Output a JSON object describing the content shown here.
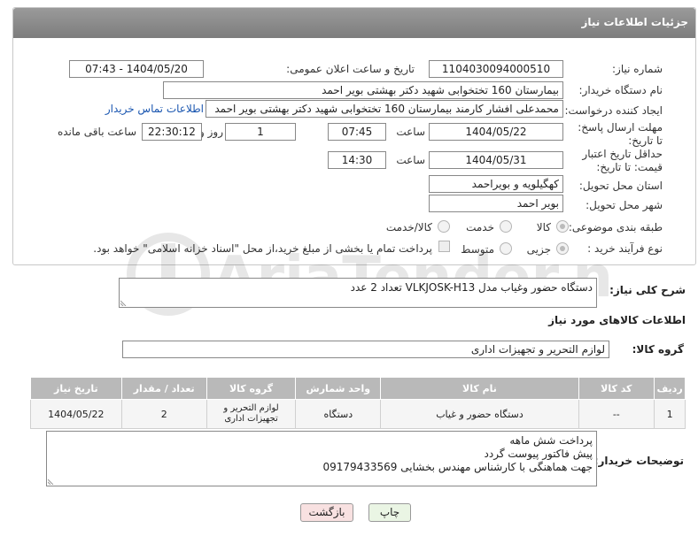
{
  "header": {
    "title": "جزئیات اطلاعات نیاز"
  },
  "form": {
    "need_number_label": "شماره نیاز:",
    "need_number": "1104030094000510",
    "announce_label": "تاریخ و ساعت اعلان عمومی:",
    "announce_value": "1404/05/20 - 07:43",
    "buyer_org_label": "نام دستگاه خریدار:",
    "buyer_org": "بیمارستان 160 تختخوابی شهید دکتر بهشتی بویر احمد",
    "creator_label": "ایجاد کننده درخواست:",
    "creator": "محمدعلی افشار کارمند بیمارستان 160 تختخوابی شهید دکتر بهشتی بویر احمد",
    "contact_link": "اطلاعات تماس خریدار",
    "deadline_label": "مهلت ارسال پاسخ: تا تاریخ:",
    "deadline_date": "1404/05/22",
    "time_label": "ساعت",
    "deadline_time": "07:45",
    "days_value": "1",
    "days_label": "روز و",
    "remaining_time": "22:30:12",
    "remaining_label": "ساعت باقی مانده",
    "validity_label": "حداقل تاریخ اعتبار قیمت: تا تاریخ:",
    "validity_date": "1404/05/31",
    "validity_time": "14:30",
    "province_label": "استان محل تحویل:",
    "province": "کهگیلویه و بویراحمد",
    "city_label": "شهر محل تحویل:",
    "city": "بویر احمد",
    "category_label": "طبقه بندی موضوعی:",
    "category_options": [
      "کالا",
      "خدمت",
      "کالا/خدمت"
    ],
    "category_selected": "کالا",
    "process_label": "نوع فرآیند خرید :",
    "process_options": [
      "جزیی",
      "متوسط"
    ],
    "process_selected": "جزیی",
    "payment_note": "پرداخت تمام یا بخشی از مبلغ خرید،از محل \"اسناد خزانه اسلامی\" خواهد بود."
  },
  "description": {
    "label": "شرح کلی نیاز:",
    "text": "دستگاه حضور وغیاب مدل  VLKJOSK-H13  تعداد 2 عدد"
  },
  "goods": {
    "section_title": "اطلاعات کالاهای مورد نیاز",
    "group_label": "گروه کالا:",
    "group_value": "لوازم التحریر و تجهیزات اداری",
    "columns": [
      "ردیف",
      "کد کالا",
      "نام کالا",
      "واحد شمارش",
      "گروه کالا",
      "تعداد / مقدار",
      "تاریخ نیاز"
    ],
    "rows": [
      {
        "row": "1",
        "code": "--",
        "name": "دستگاه حضور و غیاب",
        "unit": "دستگاه",
        "group": "لوازم التحریر و تجهیزات اداری",
        "qty": "2",
        "date": "1404/05/22"
      }
    ]
  },
  "buyer_notes": {
    "label": "توضیحات خریدار:",
    "lines": [
      "پرداخت شش ماهه",
      "پیش فاکتور پیوست گردد",
      "جهت هماهنگی با کارشناس مهندس بخشایی 09179433569"
    ]
  },
  "buttons": {
    "print": "چاپ",
    "back": "بازگشت"
  },
  "watermark": {
    "text": "AriaTender.neT"
  },
  "colors": {
    "header": "#8a8a8a",
    "link": "#1a56b0",
    "table_header": "#b9b9b9",
    "print_btn": "#eaf5e4",
    "back_btn": "#f8e1e1"
  }
}
